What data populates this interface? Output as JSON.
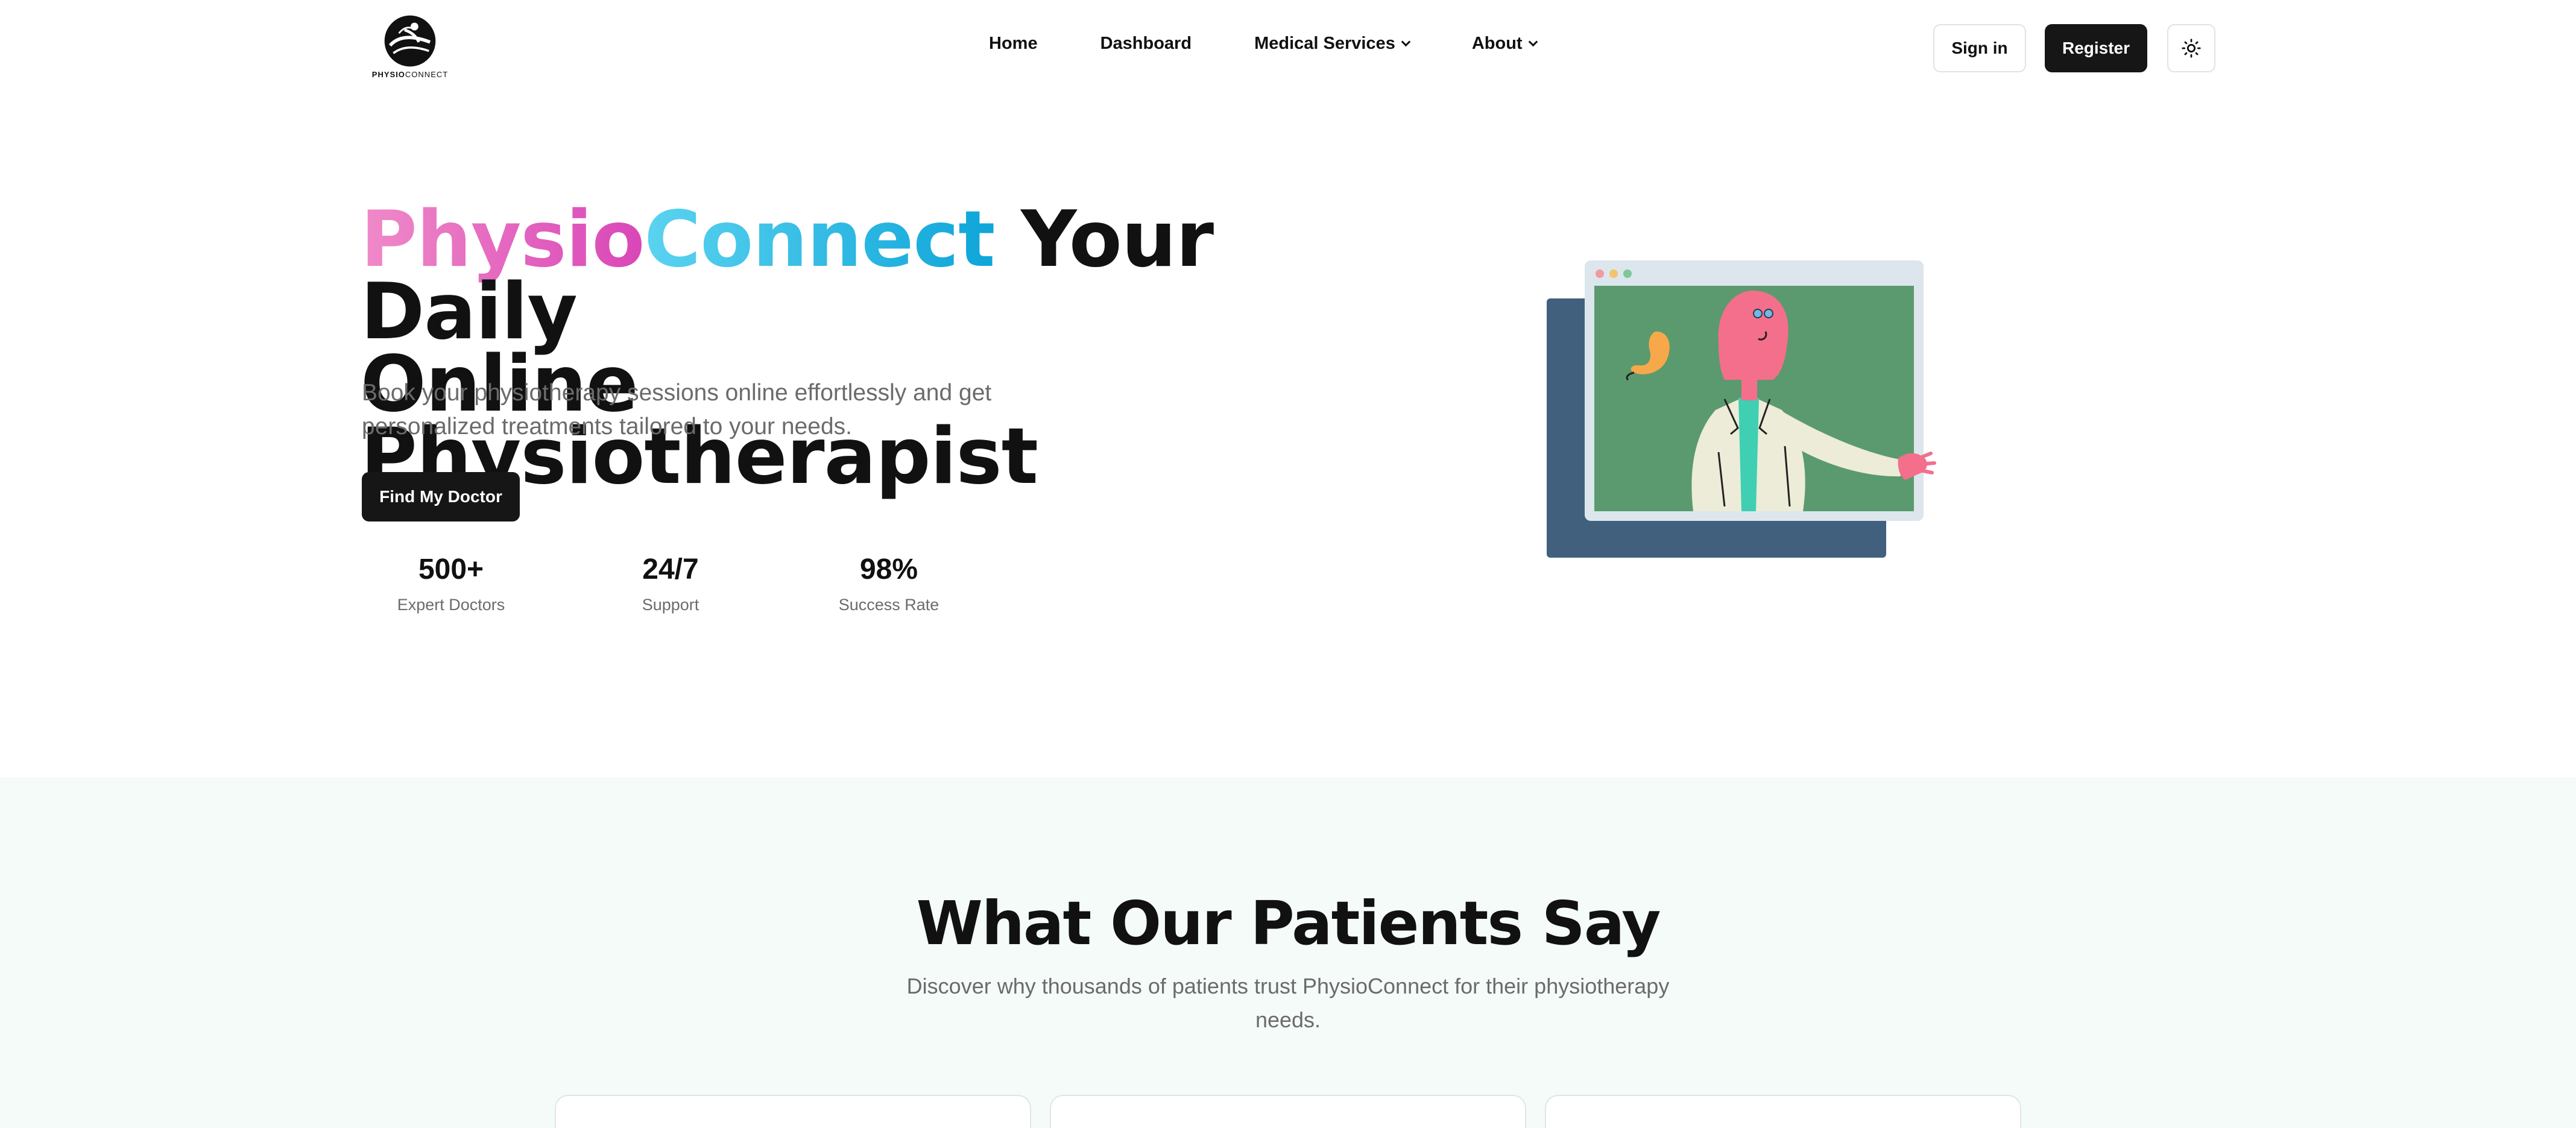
{
  "header": {
    "logo": {
      "brand_bold": "PHYSIO",
      "brand_light": "CONNECT"
    },
    "nav": [
      {
        "label": "Home",
        "has_dropdown": false
      },
      {
        "label": "Dashboard",
        "has_dropdown": false
      },
      {
        "label": "Medical Services",
        "has_dropdown": true
      },
      {
        "label": "About",
        "has_dropdown": true
      }
    ],
    "sign_in_label": "Sign in",
    "register_label": "Register",
    "theme_toggle_icon": "sun-icon"
  },
  "hero": {
    "title_physio": "Physio",
    "title_connect": "Connect",
    "title_rest_line1": " Your Daily",
    "title_line2": "Online Physiotherapist",
    "subtitle": "Book your physiotherapy sessions online effortlessly and get personalized treatments tailored to your needs.",
    "cta_label": "Find My Doctor",
    "stats": [
      {
        "value": "500+",
        "label": "Expert Doctors"
      },
      {
        "value": "24/7",
        "label": "Support"
      },
      {
        "value": "98%",
        "label": "Success Rate"
      }
    ]
  },
  "testimonials": {
    "title": "What Our Patients Say",
    "subtitle": "Discover why thousands of patients trust PhysioConnect for their physiotherapy needs."
  },
  "colors": {
    "primary_dark": "#161616",
    "physio_gradient": [
      "#f08ac8",
      "#d946b8"
    ],
    "connect_gradient": [
      "#5bd3f0",
      "#0ea5d9"
    ],
    "section_bg": "#f4fbf8",
    "muted_text": "#6b6b6b"
  }
}
